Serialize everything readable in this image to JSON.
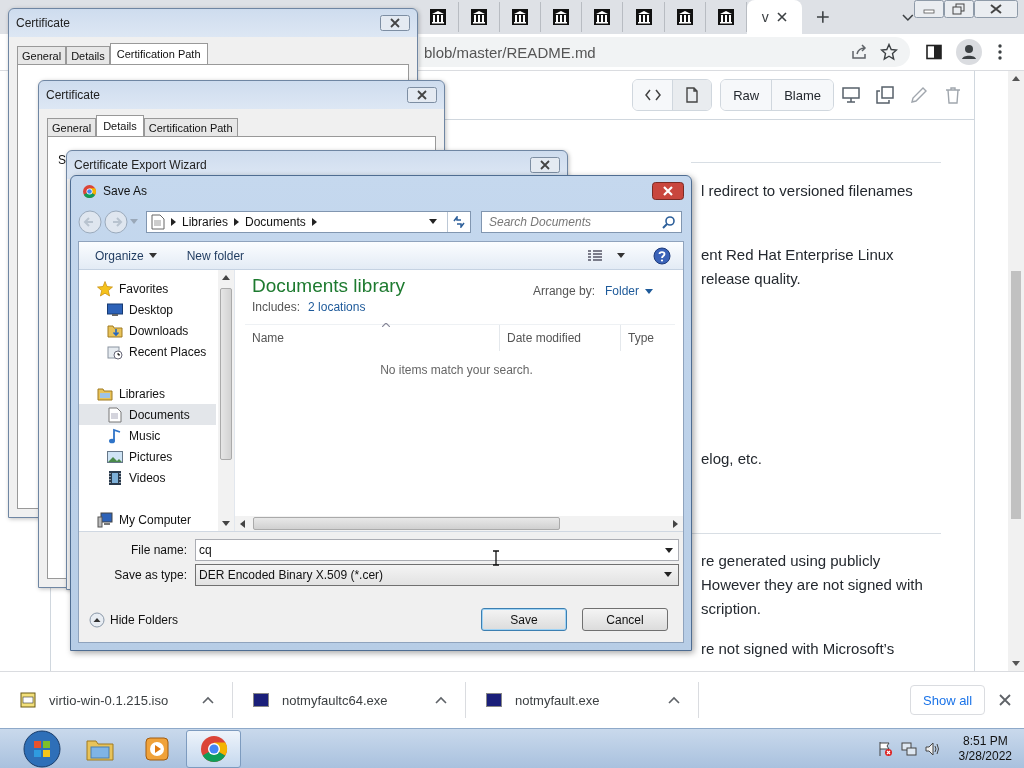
{
  "browser": {
    "tabs": [
      {
        "selected": false
      },
      {
        "selected": false
      },
      {
        "selected": false
      },
      {
        "selected": false
      },
      {
        "selected": false
      },
      {
        "selected": false
      },
      {
        "selected": false
      },
      {
        "selected": false
      },
      {
        "label": "v",
        "selected": true
      }
    ],
    "address": "blob/master/README.md",
    "file_view": [
      {
        "kind": "code",
        "selected": false
      },
      {
        "kind": "file",
        "selected": true
      }
    ],
    "file_buttons": [
      "Raw",
      "Blame"
    ],
    "readme": [
      {
        "kind": "rule"
      },
      {
        "kind": "paragraph",
        "lines": [
          "l redirect to versioned filenames"
        ]
      },
      {
        "kind": "paragraph",
        "lines": [
          "ent Red Hat Enterprise Linux",
          "release quality."
        ]
      },
      {
        "kind": "paragraph",
        "lines": [
          "elog, etc."
        ]
      },
      {
        "kind": "rule"
      },
      {
        "kind": "paragraph",
        "lines": [
          "re generated using publicly",
          "However they are not signed with",
          "scription."
        ]
      },
      {
        "kind": "paragraph",
        "lines": [
          "re not signed with Microsoft’s"
        ]
      }
    ]
  },
  "windows": [
    {
      "kind": "certificate",
      "title": "Certificate",
      "tabs": [
        {
          "label": "General",
          "selected": false
        },
        {
          "label": "Details",
          "selected": false
        },
        {
          "label": "Certification Path",
          "selected": true
        }
      ]
    },
    {
      "kind": "certificate",
      "title": "Certificate",
      "tabs": [
        {
          "label": "General",
          "selected": false
        },
        {
          "label": "Details",
          "selected": true
        },
        {
          "label": "Certification Path",
          "selected": false
        }
      ],
      "fragments": [
        "S"
      ]
    },
    {
      "kind": "wizard",
      "title": "Certificate Export Wizard"
    }
  ],
  "save_as": {
    "title": "Save As",
    "path": [
      "Libraries",
      "Documents"
    ],
    "search": {
      "placeholder": "Search Documents"
    },
    "toolbar": {
      "organize": "Organize",
      "new_folder": "New folder"
    },
    "nav": [
      {
        "label": "Favorites",
        "kind": "star",
        "selected": false,
        "children": [
          {
            "label": "Desktop",
            "kind": "desktop",
            "selected": false
          },
          {
            "label": "Downloads",
            "kind": "downloads",
            "selected": false
          },
          {
            "label": "Recent Places",
            "kind": "recent",
            "selected": false
          }
        ]
      },
      {
        "label": "Libraries",
        "kind": "libraries",
        "selected": false,
        "children": [
          {
            "label": "Documents",
            "kind": "documents",
            "selected": true
          },
          {
            "label": "Music",
            "kind": "music",
            "selected": false
          },
          {
            "label": "Pictures",
            "kind": "pictures",
            "selected": false
          },
          {
            "label": "Videos",
            "kind": "videos",
            "selected": false
          }
        ]
      },
      {
        "label": "My Computer",
        "kind": "computer",
        "selected": false
      }
    ],
    "library": {
      "title": "Documents library",
      "includes_label": "Includes:",
      "includes_link": "2 locations",
      "arrange_label": "Arrange by:",
      "arrange_value": "Folder"
    },
    "columns": [
      "Name",
      "Date modified",
      "Type"
    ],
    "empty_message": "No items match your search.",
    "file_name": {
      "label": "File name:",
      "value": "cq"
    },
    "file_type": {
      "label": "Save as type:",
      "value": "DER Encoded Binary X.509 (*.cer)"
    },
    "hide_folders": "Hide Folders",
    "buttons": [
      "Save",
      "Cancel"
    ]
  },
  "downloads": {
    "items": [
      {
        "name": "virtio-win-0.1.215.iso",
        "kind": "disc"
      },
      {
        "name": "notmyfaultc64.exe",
        "kind": "exe"
      },
      {
        "name": "notmyfault.exe",
        "kind": "exe"
      }
    ],
    "show_all": "Show all"
  },
  "taskbar": {
    "apps": [
      {
        "kind": "explorer",
        "selected": false
      },
      {
        "kind": "media",
        "selected": false
      },
      {
        "kind": "chrome",
        "selected": true
      }
    ],
    "time": "8:51 PM",
    "date": "3/28/2022"
  }
}
